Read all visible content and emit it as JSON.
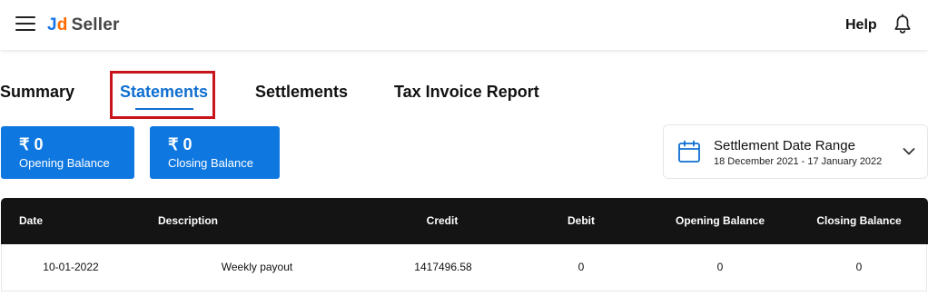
{
  "header": {
    "logo": {
      "j": "J",
      "d": "d",
      "seller": "Seller"
    },
    "help_label": "Help",
    "menu_icon": "hamburger-icon",
    "notification_icon": "bell-icon"
  },
  "tabs": [
    {
      "label": "Summary",
      "active": false
    },
    {
      "label": "Statements",
      "active": true
    },
    {
      "label": "Settlements",
      "active": false
    },
    {
      "label": "Tax Invoice Report",
      "active": false
    }
  ],
  "balances": {
    "opening": {
      "amount": "₹ 0",
      "label": "Opening Balance"
    },
    "closing": {
      "amount": "₹ 0",
      "label": "Closing Balance"
    }
  },
  "date_range": {
    "title": "Settlement Date Range",
    "value": "18 December 2021 - 17 January 2022",
    "icon": "calendar-icon"
  },
  "table": {
    "headers": [
      "Date",
      "Description",
      "Credit",
      "Debit",
      "Opening Balance",
      "Closing Balance"
    ],
    "rows": [
      [
        "10-01-2022",
        "Weekly payout",
        "1417496.58",
        "0",
        "0",
        "0"
      ]
    ]
  },
  "colors": {
    "accent": "#0f6fd0",
    "card": "#0f78e0",
    "highlight": "#c8141b",
    "table_header": "#141414"
  }
}
